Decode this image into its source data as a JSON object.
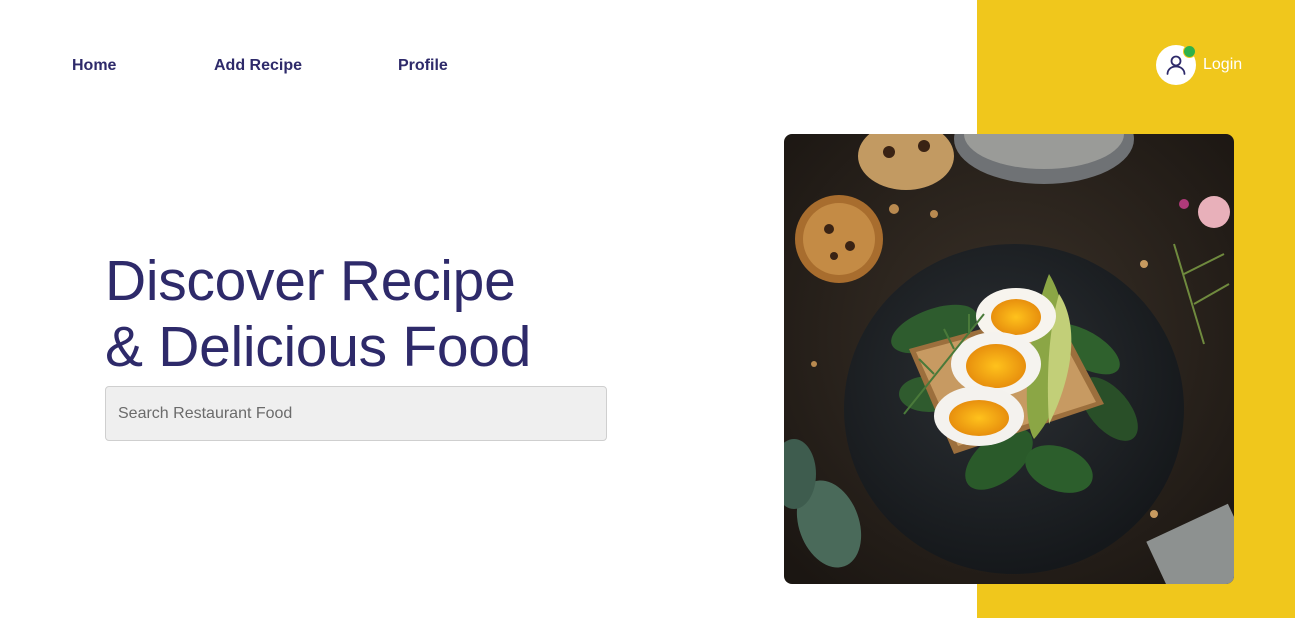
{
  "nav": {
    "items": [
      {
        "label": "Home"
      },
      {
        "label": "Add Recipe"
      },
      {
        "label": "Profile"
      }
    ]
  },
  "login": {
    "label": "Login",
    "avatar_icon": "user-icon",
    "status_color": "#2fb14a"
  },
  "hero": {
    "title_line1": "Discover Recipe",
    "title_line2": "& Delicious Food"
  },
  "search": {
    "placeholder": "Search Restaurant Food",
    "value": ""
  },
  "image": {
    "icon": "food-photo"
  },
  "colors": {
    "accent_yellow": "#f0c71c",
    "heading": "#2e2a6a"
  }
}
